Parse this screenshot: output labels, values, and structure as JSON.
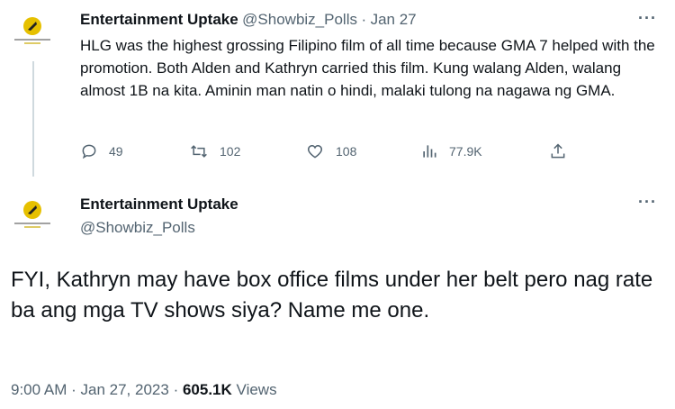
{
  "quoted_tweet": {
    "author_name": "Entertainment Uptake",
    "handle": "@Showbiz_Polls",
    "separator": "·",
    "date": "Jan 27",
    "text": "HLG was the highest grossing Filipino film of all time because GMA 7 helped with the promotion. Both Alden and Kathryn carried this film. Kung walang Alden, walang almost 1B na kita. Aminin man natin o hindi, malaki tulong na nagawa ng GMA.",
    "actions": {
      "replies": "49",
      "retweets": "102",
      "likes": "108",
      "views": "77.9K"
    },
    "more_label": "···"
  },
  "main_tweet": {
    "author_name": "Entertainment Uptake",
    "handle": "@Showbiz_Polls",
    "text": "FYI, Kathryn may have box office films under her belt pero nag rate ba ang mga TV shows siya? Name me one.",
    "time": "9:00 AM",
    "separator": "·",
    "date": "Jan 27, 2023",
    "separator2": "·",
    "views_count": "605.1K",
    "views_label": "Views",
    "more_label": "···"
  },
  "icons": [
    "reply-icon",
    "retweet-icon",
    "like-icon",
    "views-icon",
    "share-icon",
    "more-icon"
  ],
  "colors": {
    "text": "#0f1419",
    "secondary": "#536471",
    "thread_line": "#cfd9de",
    "logo_yellow": "#e6c000"
  }
}
